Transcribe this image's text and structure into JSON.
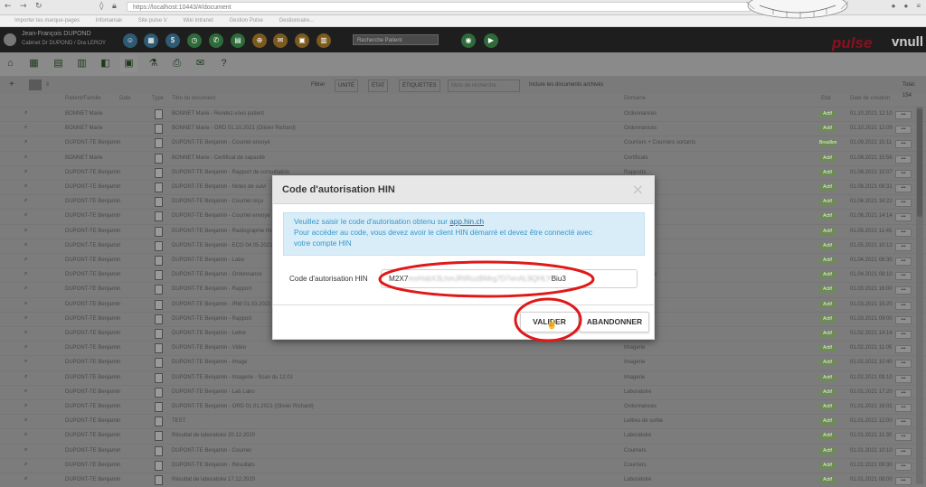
{
  "browser": {
    "url": "https://localhost:10443/#/document",
    "bookmarks": [
      "Importer les marque-pages",
      "Infomaniak",
      "Site pulse V",
      "Wiki Intranet",
      "Gestion Pulse",
      "Gestionnaire..."
    ]
  },
  "app": {
    "user_name": "Jean-François DUPOND",
    "cabinet": "Cabinet Dr DUPOND / Dra LEROY",
    "search_placeholder": "Recherche Patient",
    "logo_text": "pulse",
    "brand_text": "vnull"
  },
  "filterbar": {
    "filtrer": "Filtrer",
    "unite": "UNITÉ",
    "etat": "ÉTAT",
    "etiquettes": "ÉTIQUETTES",
    "mots_placeholder": "Mots de recherche",
    "archived_label": "Inclure les documents archivés",
    "total": "Total: 154"
  },
  "table": {
    "headers": [
      "",
      "Patient/Famille",
      "Date",
      "Type",
      "Titre du document",
      "Domaine",
      "Etat",
      "Date de création"
    ],
    "rows": [
      {
        "patient": "BONNET Marie",
        "title": "BONNET Marie - Rendez-vous patient",
        "domain": "Ordonnances",
        "state": "Actif",
        "date": "01.10.2021 12:10"
      },
      {
        "patient": "BONNET Marie",
        "title": "BONNET Marie - ORD 01.10.2021 (Olivier Richard)",
        "domain": "Ordonnances",
        "state": "Actif",
        "date": "01.10.2021 12:09"
      },
      {
        "patient": "DUPONT-TE Benjamin",
        "title": "DUPONT-TE Benjamin - Courriel envoyé",
        "domain": "Courriers + Courriers sortants",
        "state": "Brouillon",
        "date": "01.09.2021 15:11"
      },
      {
        "patient": "BONNET Marie",
        "title": "BONNET Marie - Certificat de capacité",
        "domain": "Certificats",
        "state": "Actif",
        "date": "01.08.2021 15:56"
      },
      {
        "patient": "DUPONT-TE Benjamin",
        "title": "DUPONT-TE Benjamin - Rapport de consultation",
        "domain": "Rapports",
        "state": "Actif",
        "date": "01.08.2021 10:07"
      },
      {
        "patient": "DUPONT-TE Benjamin",
        "title": "DUPONT-TE Benjamin - Notes de suivi",
        "domain": "Rapports",
        "state": "Actif",
        "date": "01.08.2021 09:31"
      },
      {
        "patient": "DUPONT-TE Benjamin",
        "title": "DUPONT-TE Benjamin - Courriel reçu",
        "domain": "Courriers",
        "state": "Actif",
        "date": "01.06.2021 16:22"
      },
      {
        "patient": "DUPONT-TE Benjamin",
        "title": "DUPONT-TE Benjamin - Courriel envoyé",
        "domain": "Courriers",
        "state": "Actif",
        "date": "01.06.2021 14:14"
      },
      {
        "patient": "DUPONT-TE Benjamin",
        "title": "DUPONT-TE Benjamin - Radiographie thorax",
        "domain": "Imagerie",
        "state": "Actif",
        "date": "01.05.2021 11:45"
      },
      {
        "patient": "DUPONT-TE Benjamin",
        "title": "DUPONT-TE Benjamin - ECG 04.05.2021",
        "domain": "Examens",
        "state": "Actif",
        "date": "01.05.2021 10:12"
      },
      {
        "patient": "DUPONT-TE Benjamin",
        "title": "DUPONT-TE Benjamin - Labo",
        "domain": "Laboratoire",
        "state": "Actif",
        "date": "01.04.2021 08:30"
      },
      {
        "patient": "DUPONT-TE Benjamin",
        "title": "DUPONT-TE Benjamin - Ordonnance",
        "domain": "Ordonnances",
        "state": "Actif",
        "date": "01.04.2021 08:10"
      },
      {
        "patient": "DUPONT-TE Benjamin",
        "title": "DUPONT-TE Benjamin - Rapport",
        "domain": "Rapports",
        "state": "Actif",
        "date": "01.03.2021 16:00"
      },
      {
        "patient": "DUPONT-TE Benjamin",
        "title": "DUPONT-TE Benjamin - IRM 01.03.2021 résultats",
        "domain": "Imagerie",
        "state": "Actif",
        "date": "01.03.2021 15:20"
      },
      {
        "patient": "DUPONT-TE Benjamin",
        "title": "DUPONT-TE Benjamin - Rapport",
        "domain": "Rapports",
        "state": "Actif",
        "date": "01.03.2021 09:00"
      },
      {
        "patient": "DUPONT-TE Benjamin",
        "title": "DUPONT-TE Benjamin - Lettre",
        "domain": "Courriers",
        "state": "Actif",
        "date": "01.02.2021 14:14"
      },
      {
        "patient": "DUPONT-TE Benjamin",
        "title": "DUPONT-TE Benjamin - Vidéo",
        "domain": "Imagerie",
        "state": "Actif",
        "date": "01.02.2021 11:05"
      },
      {
        "patient": "DUPONT-TE Benjamin",
        "title": "DUPONT-TE Benjamin - Image",
        "domain": "Imagerie",
        "state": "Actif",
        "date": "01.02.2021 10:40"
      },
      {
        "patient": "DUPONT-TE Benjamin",
        "title": "DUPONT-TE Benjamin - Imagerie - Scan du 12.01",
        "domain": "Imagerie",
        "state": "Actif",
        "date": "01.02.2021 09:10"
      },
      {
        "patient": "DUPONT-TE Benjamin",
        "title": "DUPONT-TE Benjamin - Lab Labo",
        "domain": "Laboratoire",
        "state": "Actif",
        "date": "01.01.2021 17:20"
      },
      {
        "patient": "DUPONT-TE Benjamin",
        "title": "DUPONT-TE Benjamin - ORD 01.01.2021 (Olivier Richard)",
        "domain": "Ordonnances",
        "state": "Actif",
        "date": "01.01.2021 16:02"
      },
      {
        "patient": "DUPONT-TE Benjamin",
        "title": "TEST",
        "domain": "Lettres de sortie",
        "state": "Actif",
        "date": "01.01.2021 12:00"
      },
      {
        "patient": "DUPONT-TE Benjamin",
        "title": "Résultat de laboratoire 20.12.2020",
        "domain": "Laboratoire",
        "state": "Actif",
        "date": "01.01.2021 11:30"
      },
      {
        "patient": "DUPONT-TE Benjamin",
        "title": "DUPONT-TE Benjamin - Courriel",
        "domain": "Courriers",
        "state": "Actif",
        "date": "01.01.2021 10:10"
      },
      {
        "patient": "DUPONT-TE Benjamin",
        "title": "DUPONT-TE Benjamin - Résultats",
        "domain": "Courriers",
        "state": "Actif",
        "date": "01.01.2021 09:30"
      },
      {
        "patient": "DUPONT-TE Benjamin",
        "title": "Résultat de laboratoire 17.12.2020",
        "domain": "Laboratoire",
        "state": "Actif",
        "date": "01.01.2021 08:00"
      }
    ]
  },
  "modal": {
    "title": "Code d'autorisation HIN",
    "close": "×",
    "info_line1_prefix": "Veuillez saisir le code d'autorisation obtenu sur ",
    "info_link": "app.hin.ch",
    "info_line2": "Pour accéder au code, vous devez avoir le client HIN démarré et devez être connecté avec",
    "info_line3": "votre compte HIN",
    "code_label": "Code d'autorisation HIN",
    "code_prefix": "M2X7",
    "code_hidden": "mvHsbX3LhmJRtRuzBMrg7D7enAL9QHLY",
    "code_suffix": "Biu3",
    "valider": "VALIDER",
    "abandonner": "ABANDONNER"
  },
  "colors": {
    "annotation": "#e01818",
    "info_text": "#3597cd",
    "info_bg": "#d8edf8",
    "brand_red": "#8a1020"
  }
}
